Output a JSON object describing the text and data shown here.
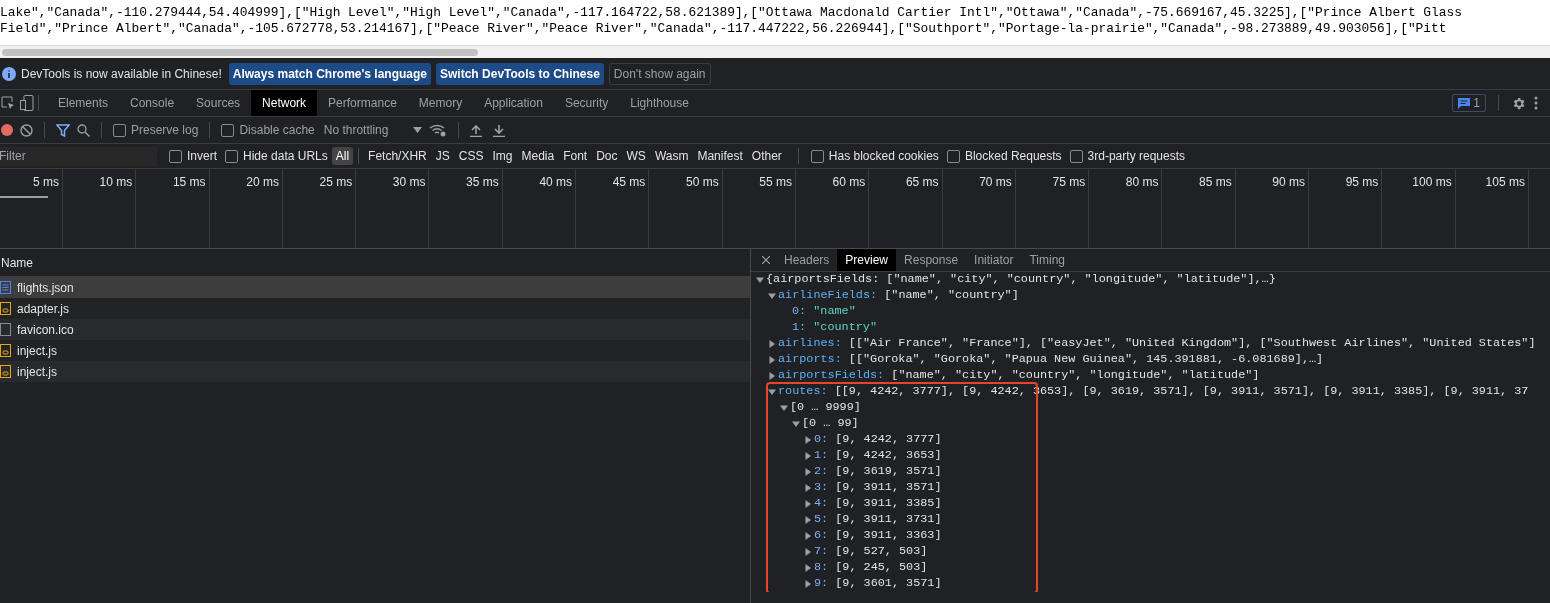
{
  "page_text": {
    "lines": [
      "Lake\",\"Canada\",-110.279444,54.404999],[\"High Level\",\"High Level\",\"Canada\",-117.164722,58.621389],[\"Ottawa Macdonald Cartier Intl\",\"Ottawa\",\"Canada\",-75.669167,45.3225],[\"Prince Albert Glass",
      "Field\",\"Prince Albert\",\"Canada\",-105.672778,53.214167],[\"Peace River\",\"Peace River\",\"Canada\",-117.447222,56.226944],[\"Southport\",\"Portage-la-prairie\",\"Canada\",-98.273889,49.903056],[\"Pitt"
    ]
  },
  "infobar": {
    "message": "DevTools is now available in Chinese!",
    "buttons": [
      {
        "label": "Always match Chrome's language",
        "kind": "primary"
      },
      {
        "label": "Switch DevTools to Chinese",
        "kind": "primary"
      },
      {
        "label": "Don't show again",
        "kind": "secondary"
      }
    ]
  },
  "main_tabs": [
    {
      "label": "Elements",
      "selected": false
    },
    {
      "label": "Console",
      "selected": false
    },
    {
      "label": "Sources",
      "selected": false
    },
    {
      "label": "Network",
      "selected": true
    },
    {
      "label": "Performance",
      "selected": false
    },
    {
      "label": "Memory",
      "selected": false
    },
    {
      "label": "Application",
      "selected": false
    },
    {
      "label": "Security",
      "selected": false
    },
    {
      "label": "Lighthouse",
      "selected": false
    }
  ],
  "issues_badge": "1",
  "toolbar": {
    "checkboxes": [
      {
        "label": "Preserve log",
        "checked": false
      },
      {
        "label": "Disable cache",
        "checked": false
      }
    ],
    "throttling": "No throttling"
  },
  "filter_bar": {
    "placeholder": "Filter",
    "checkboxes": [
      {
        "label": "Invert",
        "checked": false
      },
      {
        "label": "Hide data URLs",
        "checked": false
      }
    ],
    "types": [
      {
        "label": "All",
        "selected": true
      },
      {
        "label": "Fetch/XHR",
        "selected": false
      },
      {
        "label": "JS",
        "selected": false
      },
      {
        "label": "CSS",
        "selected": false
      },
      {
        "label": "Img",
        "selected": false
      },
      {
        "label": "Media",
        "selected": false
      },
      {
        "label": "Font",
        "selected": false
      },
      {
        "label": "Doc",
        "selected": false
      },
      {
        "label": "WS",
        "selected": false
      },
      {
        "label": "Wasm",
        "selected": false
      },
      {
        "label": "Manifest",
        "selected": false
      },
      {
        "label": "Other",
        "selected": false
      }
    ],
    "more_checkboxes": [
      {
        "label": "Has blocked cookies",
        "checked": false
      },
      {
        "label": "Blocked Requests",
        "checked": false
      },
      {
        "label": "3rd-party requests",
        "checked": false
      }
    ]
  },
  "timeline_ticks": [
    "5 ms",
    "10 ms",
    "15 ms",
    "20 ms",
    "25 ms",
    "30 ms",
    "35 ms",
    "40 ms",
    "45 ms",
    "50 ms",
    "55 ms",
    "60 ms",
    "65 ms",
    "70 ms",
    "75 ms",
    "80 ms",
    "85 ms",
    "90 ms",
    "95 ms",
    "100 ms",
    "105 ms"
  ],
  "requests": {
    "column": "Name",
    "rows": [
      {
        "name": "flights.json",
        "kind": "document",
        "selected": true
      },
      {
        "name": "adapter.js",
        "kind": "script",
        "selected": false
      },
      {
        "name": "favicon.ico",
        "kind": "other",
        "selected": false
      },
      {
        "name": "inject.js",
        "kind": "script",
        "selected": false
      },
      {
        "name": "inject.js",
        "kind": "script",
        "selected": false
      }
    ]
  },
  "detail_tabs": [
    {
      "label": "Headers",
      "selected": false
    },
    {
      "label": "Preview",
      "selected": true
    },
    {
      "label": "Response",
      "selected": false
    },
    {
      "label": "Initiator",
      "selected": false
    },
    {
      "label": "Timing",
      "selected": false
    }
  ],
  "preview_tree": [
    {
      "value": "{airportsFields: [\"name\", \"city\", \"country\", \"longitude\", \"latitude\"],…}",
      "expanded": true,
      "children": [
        {
          "key": "airlineFields:",
          "value": "[\"name\", \"country\"]",
          "expanded": true,
          "children": [
            {
              "key": "0:",
              "value": "\"name\"",
              "kind": "string"
            },
            {
              "key": "1:",
              "value": "\"country\"",
              "kind": "string"
            }
          ]
        },
        {
          "key": "airlines:",
          "value": "[[\"Air France\", \"France\"], [\"easyJet\", \"United Kingdom\"], [\"Southwest Airlines\", \"United States\"]",
          "expanded": false
        },
        {
          "key": "airports:",
          "value": "[[\"Goroka\", \"Goroka\", \"Papua New Guinea\", 145.391881, -6.081689],…]",
          "expanded": false
        },
        {
          "key": "airportsFields:",
          "value": "[\"name\", \"city\", \"country\", \"longitude\", \"latitude\"]",
          "expanded": false
        },
        {
          "key": "routes:",
          "value": "[[9, 4242, 3777], [9, 4242, 3653], [9, 3619, 3571], [9, 3911, 3571], [9, 3911, 3385], [9, 3911, 37",
          "expanded": true,
          "children": [
            {
              "value": "[0 … 9999]",
              "expanded": true,
              "children": [
                {
                  "value": "[0 … 99]",
                  "expanded": true,
                  "children": [
                    {
                      "key": "0:",
                      "value": "[9, 4242, 3777]",
                      "kind": "index",
                      "expanded": false
                    },
                    {
                      "key": "1:",
                      "value": "[9, 4242, 3653]",
                      "kind": "index",
                      "expanded": false
                    },
                    {
                      "key": "2:",
                      "value": "[9, 3619, 3571]",
                      "kind": "index",
                      "expanded": false
                    },
                    {
                      "key": "3:",
                      "value": "[9, 3911, 3571]",
                      "kind": "index",
                      "expanded": false
                    },
                    {
                      "key": "4:",
                      "value": "[9, 3911, 3385]",
                      "kind": "index",
                      "expanded": false
                    },
                    {
                      "key": "5:",
                      "value": "[9, 3911, 3731]",
                      "kind": "index",
                      "expanded": false
                    },
                    {
                      "key": "6:",
                      "value": "[9, 3911, 3363]",
                      "kind": "index",
                      "expanded": false
                    },
                    {
                      "key": "7:",
                      "value": "[9, 527, 503]",
                      "kind": "index",
                      "expanded": false
                    },
                    {
                      "key": "8:",
                      "value": "[9, 245, 503]",
                      "kind": "index",
                      "expanded": false
                    },
                    {
                      "key": "9:",
                      "value": "[9, 3601, 3571]",
                      "kind": "index",
                      "expanded": false
                    }
                  ]
                }
              ]
            }
          ]
        }
      ]
    }
  ]
}
